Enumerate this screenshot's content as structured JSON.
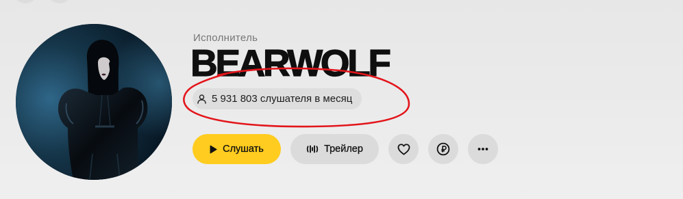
{
  "artist": {
    "type_label": "Исполнитель",
    "name": "BEARWOLF",
    "monthly_listeners": "5 931 803 слушателя в месяц",
    "listeners_icon": "user-icon"
  },
  "actions": {
    "play": {
      "label": "Слушать",
      "icon": "play-icon"
    },
    "trailer": {
      "label": "Трейлер",
      "icon": "waveform-icon"
    },
    "like": {
      "icon": "heart-icon"
    },
    "donate": {
      "icon": "ruble-icon"
    },
    "more": {
      "icon": "more-horizontal-icon"
    }
  },
  "colors": {
    "page_bg": "#ebebeb",
    "accent": "#ffcc1f",
    "button_bg": "#dbdbdb",
    "pill_bg": "#dedede",
    "text": "#111111",
    "muted_text": "#767676",
    "annotation": "#e3151b"
  }
}
